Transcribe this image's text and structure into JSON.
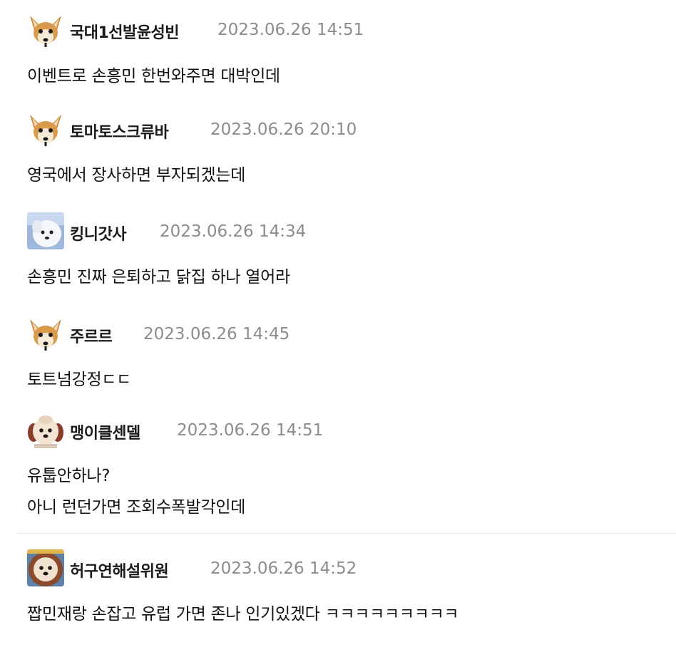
{
  "comments": [
    {
      "nickname": "국대1선발윤성빈",
      "timestamp": "2023.06.26 14:51",
      "lines": [
        "이벤트로 손흥민 한번와주면 대박인데"
      ],
      "avatar": "fennec-fox-icon"
    },
    {
      "nickname": "토마토스크류바",
      "timestamp": "2023.06.26 20:10",
      "lines": [
        "영국에서 장사하면 부자되겠는데"
      ],
      "avatar": "fennec-fox-icon"
    },
    {
      "nickname": "킹니갓사",
      "timestamp": "2023.06.26 14:34",
      "lines": [
        "손흥민 진짜 은퇴하고 닭집 하나 열어라"
      ],
      "avatar": "white-dog-icon"
    },
    {
      "nickname": "주르르",
      "timestamp": "2023.06.26 14:45",
      "lines": [
        "토트넘강정ㄷㄷ"
      ],
      "avatar": "fennec-fox-icon"
    },
    {
      "nickname": "맹이클센델",
      "timestamp": "2023.06.26 14:51",
      "lines": [
        "유툽안하나?",
        "아니 런던가면 조회수폭발각인데"
      ],
      "avatar": "fluffy-puppy-icon"
    },
    {
      "nickname": "허구연해설위원",
      "timestamp": "2023.06.26 14:52",
      "lines": [
        "짭민재랑 손잡고 유럽 가면 존나 인기있겠다 ㅋㅋㅋㅋㅋㅋㅋㅋㅋ"
      ],
      "avatar": "lion-puppy-icon"
    }
  ]
}
